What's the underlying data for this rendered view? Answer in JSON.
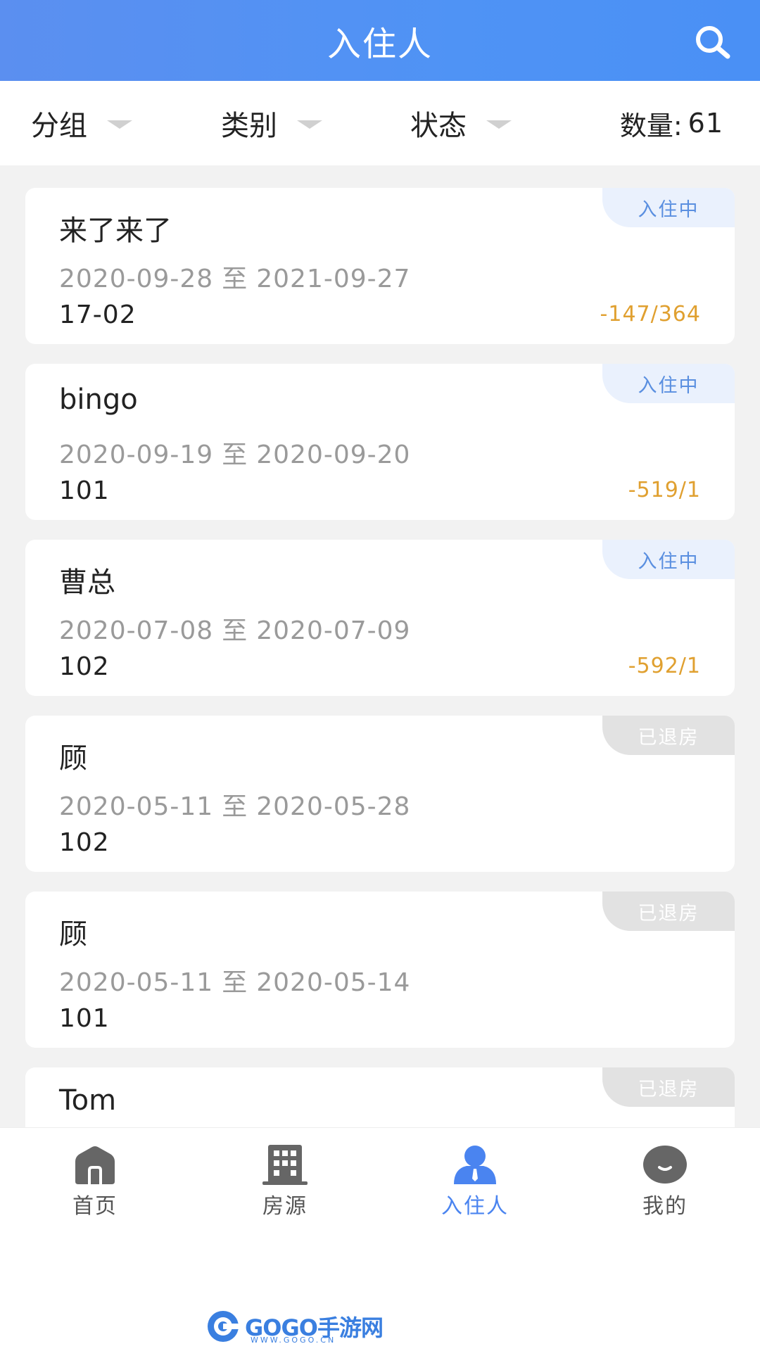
{
  "header": {
    "title": "入住人",
    "search_icon": "search-icon"
  },
  "filters": {
    "group_label": "分组",
    "category_label": "类别",
    "status_label": "状态",
    "count_label": "数量:",
    "count_value": "61"
  },
  "cards": [
    {
      "name": "来了来了",
      "start": "2020-09-28",
      "sep": "至",
      "end": "2021-09-27",
      "room": "17-02",
      "balance": "-147/364",
      "status": "入住中"
    },
    {
      "name": "bingo",
      "start": "2020-09-19",
      "sep": "至",
      "end": "2020-09-20",
      "room": "101",
      "balance": "-519/1",
      "status": "入住中"
    },
    {
      "name": "曹总",
      "start": "2020-07-08",
      "sep": "至",
      "end": "2020-07-09",
      "room": "102",
      "balance": "-592/1",
      "status": "入住中"
    },
    {
      "name": "顾",
      "start": "2020-05-11",
      "sep": "至",
      "end": "2020-05-28",
      "room": "102",
      "balance": "",
      "status": "已退房"
    },
    {
      "name": "顾",
      "start": "2020-05-11",
      "sep": "至",
      "end": "2020-05-14",
      "room": "101",
      "balance": "",
      "status": "已退房"
    },
    {
      "name": "Tom",
      "start": "",
      "sep": "",
      "end": "",
      "room": "",
      "balance": "",
      "status": "已退房"
    }
  ],
  "tabs": [
    {
      "label": "首页",
      "icon": "home-icon"
    },
    {
      "label": "房源",
      "icon": "building-icon"
    },
    {
      "label": "入住人",
      "icon": "person-icon"
    },
    {
      "label": "我的",
      "icon": "smile-icon"
    }
  ],
  "colors": {
    "header_blue": "#4f93f5",
    "active_tab": "#4a84f0",
    "balance_orange": "#e0a030",
    "badge_in_bg": "#eaf1fd",
    "badge_out_bg": "#e2e2e2"
  },
  "watermark": {
    "text": "GOGO手游网",
    "url": "WWW.GOGO.CN"
  }
}
